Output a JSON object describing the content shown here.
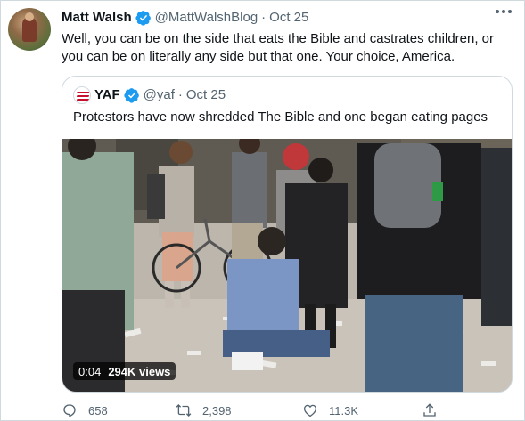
{
  "tweet": {
    "author_name": "Matt Walsh",
    "author_handle": "@MattWalshBlog",
    "separator": "·",
    "date": "Oct 25",
    "text": "Well, you can be on the side that eats the Bible and castrates children, or you can be on literally any side but that one. Your choice, America."
  },
  "quote": {
    "author_name": "YAF",
    "author_handle": "@yaf",
    "separator": "·",
    "date": "Oct 25",
    "text": "Protestors have now shredded The Bible and one began eating pages",
    "video": {
      "duration": "0:04",
      "views": "294K views"
    }
  },
  "actions": {
    "replies": "658",
    "retweets": "2,398",
    "likes": "11.3K"
  },
  "colors": {
    "verified": "#1d9bf0",
    "muted_text": "#536471",
    "border": "#cfd9de"
  },
  "icons": [
    "verified-badge-icon",
    "more-icon",
    "reply-icon",
    "retweet-icon",
    "like-icon",
    "share-icon"
  ]
}
